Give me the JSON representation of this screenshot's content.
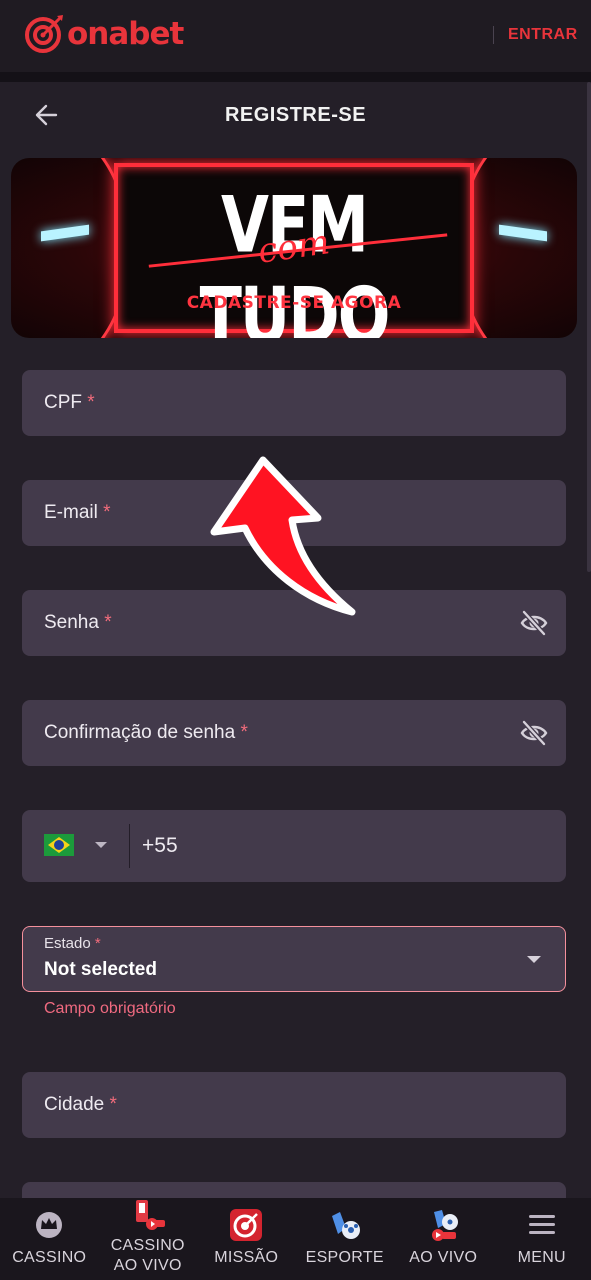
{
  "topbar": {
    "logo_text": "onabet",
    "login_label": "ENTRAR",
    "accent": "#e8343b"
  },
  "header": {
    "title": "REGISTRE-SE",
    "back_icon": "arrow-left-icon"
  },
  "banner": {
    "headline": "VEM TUDO",
    "script": "com",
    "cta": "CADASTRE-SE AGORA"
  },
  "form": {
    "cpf": {
      "label": "CPF",
      "required": "*"
    },
    "email": {
      "label": "E-mail",
      "required": "*"
    },
    "password": {
      "label": "Senha",
      "required": "*",
      "icon": "eye-slash-icon"
    },
    "password_confirm": {
      "label": "Confirmação de senha",
      "required": "*",
      "icon": "eye-slash-icon"
    },
    "phone": {
      "country_flag": "brazil-flag-icon",
      "dial_code": "+55"
    },
    "state": {
      "label": "Estado",
      "required": "*",
      "value": "Not selected",
      "error": "Campo obrigatório"
    },
    "city": {
      "label": "Cidade",
      "required": "*"
    }
  },
  "bottom_nav": {
    "items": [
      {
        "label": "CASSINO",
        "icon": "crown-icon"
      },
      {
        "label": "CASSINO AO VIVO",
        "line1": "CASSINO",
        "line2": "AO VIVO",
        "icon": "live-casino-icon"
      },
      {
        "label": "MISSÃO",
        "icon": "target-icon"
      },
      {
        "label": "ESPORTE",
        "icon": "soccer-shoe-icon"
      },
      {
        "label": "AO VIVO",
        "icon": "live-sport-icon"
      },
      {
        "label": "MENU",
        "icon": "hamburger-icon"
      }
    ]
  },
  "colors": {
    "background": "#241f28",
    "field": "#433a4b",
    "error": "#f06a80",
    "required": "#f26c7c"
  }
}
